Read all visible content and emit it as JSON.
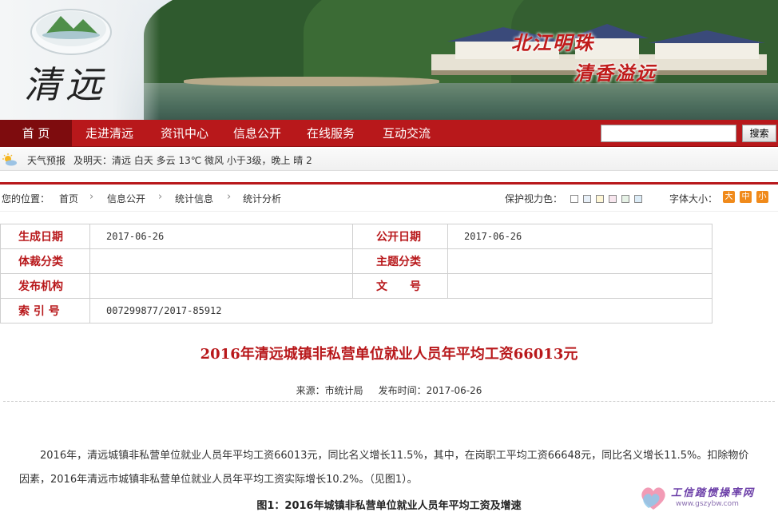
{
  "banner": {
    "logo_text": "清远",
    "slogan_left": "北江明珠",
    "slogan_right": "清香溢远"
  },
  "nav": {
    "items": [
      "首 页",
      "走进清远",
      "资讯中心",
      "信息公开",
      "在线服务",
      "互动交流"
    ],
    "active_index": 0,
    "search_placeholder": "",
    "search_button": "搜索"
  },
  "weather": {
    "label": "天气预报",
    "ticker": "及明天：清远  白天  多云  13℃  微风  小于3级，晚上  晴  2"
  },
  "breadcrumb": {
    "prefix": "您的位置：",
    "items": [
      "首页",
      "信息公开",
      "统计信息",
      "统计分析"
    ],
    "eye_label": "保护视力色：",
    "swatch_colors": [
      "#ffffff",
      "#e8f0f8",
      "#fff7d6",
      "#f8e6ee",
      "#e6f2e6",
      "#dcecf7",
      "#eeeeee"
    ],
    "font_label": "字体大小：",
    "font_buttons": [
      "大",
      "中",
      "小"
    ]
  },
  "info": {
    "date_label": "生成日期",
    "date_value": "2017-06-26",
    "publish_label": "公开日期",
    "publish_value": "2017-06-26",
    "genre_label": "体裁分类",
    "genre_value": "",
    "topic_label": "主题分类",
    "topic_value": "",
    "org_label": "发布机构",
    "org_value": "",
    "docno_label": "文　　号",
    "docno_value": "",
    "index_label": "索 引 号",
    "index_value": "007299877/2017-85912"
  },
  "article": {
    "title": "2016年清远城镇非私营单位就业人员年平均工资66013元",
    "meta": "来源：市统计局     发布时间：2017-06-26",
    "body": "2016年，清远城镇非私营单位就业人员年平均工资66013元，同比名义增长11.5%，其中，在岗职工平均工资66648元，同比名义增长11.5%。扣除物价因素，2016年清远市城镇非私营单位就业人员年平均工资实际增长10.2%。（见图1）。",
    "figure_caption": "图1：2016年城镇非私营单位就业人员年平均工资及增速"
  },
  "watermark": {
    "text": "工信踏惯操率网",
    "url": "www.gszybw.com"
  },
  "colors": {
    "brand_red": "#b8181b",
    "nav_active": "#7e0c0e",
    "font_button": "#f08a1b"
  }
}
